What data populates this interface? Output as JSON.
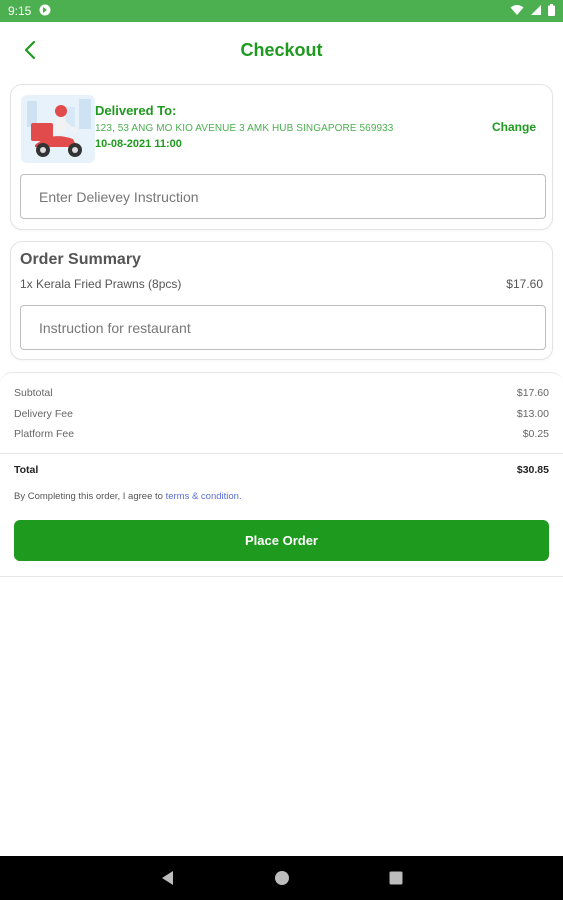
{
  "status_bar": {
    "time": "9:15"
  },
  "header": {
    "title": "Checkout"
  },
  "delivery": {
    "label": "Delivered To:",
    "address": "123, 53 ANG MO KIO AVENUE 3 AMK HUB SINGAPORE 569933",
    "datetime": "10-08-2021 11:00",
    "change_label": "Change",
    "instruction_placeholder": "Enter Delievey Instruction"
  },
  "order_summary": {
    "title": "Order Summary",
    "items": [
      {
        "name": "1x Kerala Fried Prawns (8pcs)",
        "price": "$17.60"
      }
    ],
    "restaurant_instruction_placeholder": "Instruction for restaurant"
  },
  "totals": {
    "subtotal_label": "Subtotal",
    "subtotal": "$17.60",
    "delivery_fee_label": "Delivery Fee",
    "delivery_fee": "$13.00",
    "platform_fee_label": "Platform Fee",
    "platform_fee": "$0.25",
    "total_label": "Total",
    "total": "$30.85"
  },
  "terms": {
    "prefix": "By Completing this order, I agree to ",
    "link": "terms & condition."
  },
  "place_order_label": "Place Order",
  "colors": {
    "status_bar": "#4caf50",
    "primary_green": "#1e9a1e",
    "link_blue": "#5b6fd6",
    "nav_bar": "#000000"
  },
  "icons": {
    "back": "chevron-left-icon",
    "nav_back": "triangle-back-icon",
    "nav_home": "circle-home-icon",
    "nav_recents": "square-recents-icon"
  }
}
